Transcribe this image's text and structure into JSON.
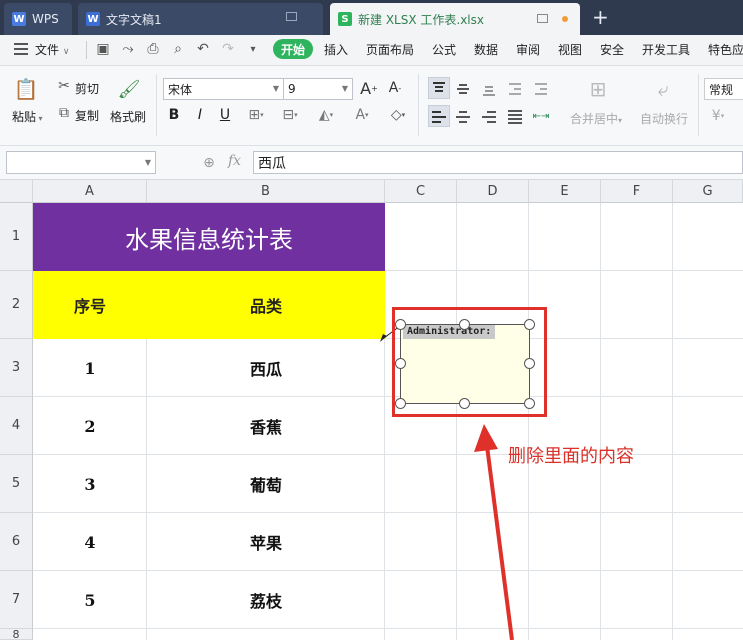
{
  "tabs": {
    "wps_label": "WPS",
    "doc_label": "文字文稿1",
    "sheet_label": "新建 XLSX 工作表.xlsx",
    "new_tab": "+"
  },
  "menu": {
    "file": "文件",
    "start": "开始",
    "items": [
      "插入",
      "页面布局",
      "公式",
      "数据",
      "审阅",
      "视图",
      "安全",
      "开发工具",
      "特色应"
    ]
  },
  "ribbon": {
    "paste": "粘贴",
    "cut": "剪切",
    "copy": "复制",
    "format_painter": "格式刷",
    "font_name": "宋体",
    "font_size": "9",
    "merge_center": "合并居中",
    "wrap_text": "自动换行",
    "number_format": "常规"
  },
  "formula_bar": {
    "name_box": "",
    "fx": "fx",
    "content": "西瓜"
  },
  "columns": [
    "A",
    "B",
    "C",
    "D",
    "E",
    "F",
    "G"
  ],
  "rows": [
    "1",
    "2",
    "3",
    "4",
    "5",
    "6",
    "7",
    "8"
  ],
  "sheet": {
    "title": "水果信息统计表",
    "header_no": "序号",
    "header_type": "品类",
    "data": [
      {
        "no": "1",
        "type": "西瓜"
      },
      {
        "no": "2",
        "type": "香蕉"
      },
      {
        "no": "3",
        "type": "葡萄"
      },
      {
        "no": "4",
        "type": "苹果"
      },
      {
        "no": "5",
        "type": "荔枝"
      }
    ],
    "title_bg": "#7030a0",
    "header_bg": "#ffff00"
  },
  "comment": {
    "author": "Administrator:"
  },
  "annotation": {
    "text": "删除里面的内容",
    "color": "#e0302a"
  }
}
